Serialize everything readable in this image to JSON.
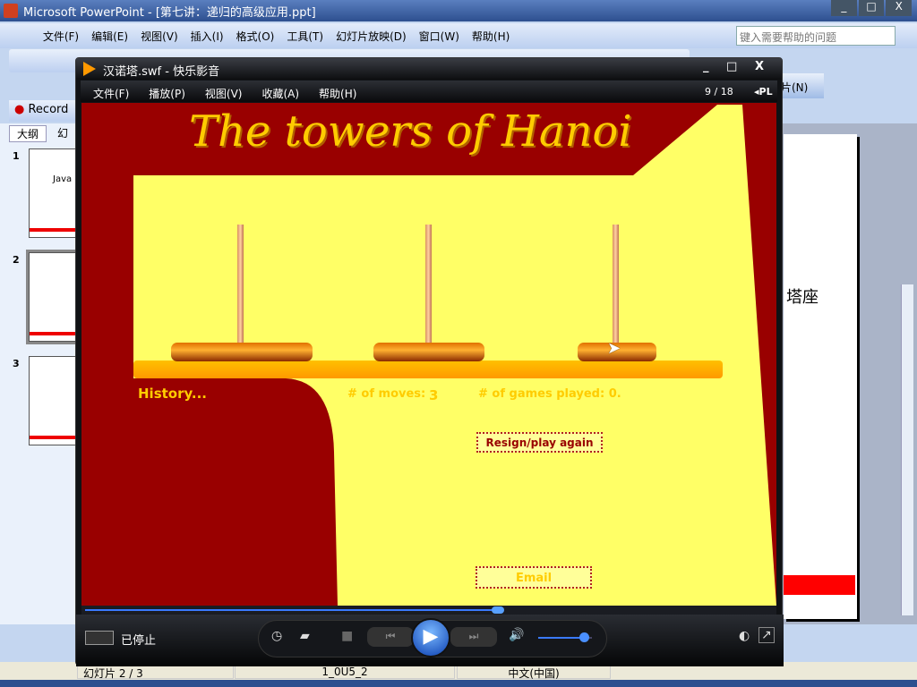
{
  "ppt": {
    "title": "Microsoft PowerPoint - [第七讲：递归的高级应用.ppt]",
    "menu": [
      "文件(F)",
      "编辑(E)",
      "视图(V)",
      "插入(I)",
      "格式(O)",
      "工具(T)",
      "幻灯片放映(D)",
      "窗口(W)",
      "帮助(H)"
    ],
    "help_placeholder": "键入需要帮助的问题",
    "record_label": "Record",
    "next_slide_label": "片(N)",
    "tabs": [
      "大纲",
      "幻"
    ],
    "thumbs": [
      "1",
      "2",
      "3"
    ],
    "thumb1_text": "Java",
    "slide_text": "塔座",
    "status": {
      "slide": "幻灯片 2 / 3",
      "design": "1_0U5_2",
      "language": "中文(中国)"
    }
  },
  "player": {
    "title": "汉诺塔.swf - 快乐影音",
    "menu": [
      "文件(F)",
      "播放(P)",
      "视图(V)",
      "收藏(A)",
      "帮助(H)"
    ],
    "counter": "9 / 18",
    "pl_label": "◂PL",
    "status": "已停止",
    "seek_progress": 0.6,
    "volume": 0.85
  },
  "game": {
    "title": "The towers of Hanoi",
    "history": "History...",
    "moves_label": "# of moves:",
    "moves": "3",
    "games_played": "# of games played: 0.",
    "resign": "Resign/play again",
    "email": "Email",
    "colors": {
      "bg": "#990000",
      "panel": "#FFFF66",
      "text": "#FFCC00",
      "disk": "#CC6600"
    }
  }
}
